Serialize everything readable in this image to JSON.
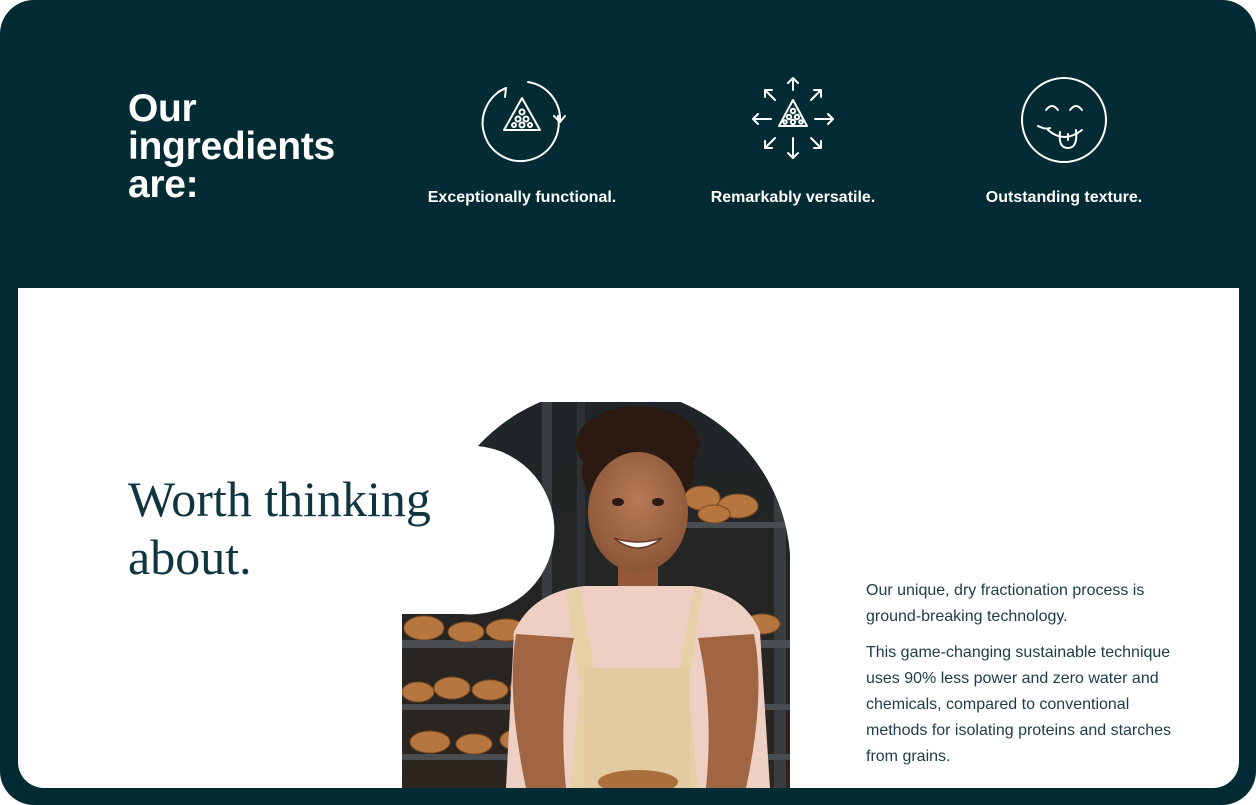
{
  "header": {
    "title_lines": [
      "Our",
      "ingredients",
      "are:"
    ],
    "features": [
      {
        "label": "Exceptionally functional.",
        "icon": "recycle-grain-icon"
      },
      {
        "label": "Remarkably versatile.",
        "icon": "expand-grain-icon"
      },
      {
        "label": "Outstanding texture.",
        "icon": "tongue-smile-icon"
      }
    ]
  },
  "section": {
    "headline_lines": [
      "Worth thinking",
      "about."
    ],
    "paragraphs": [
      "Our unique, dry fractionation process is ground-breaking technology.",
      "This game-changing sustainable technique uses 90% less power and zero water and chemicals, compared to conventional methods for isolating proteins and starches from grains."
    ],
    "image": "baker-woman-photo"
  },
  "colors": {
    "brand_dark": "#022b33",
    "text_dark": "#0f3540",
    "body_text": "#1d3c45",
    "white": "#ffffff"
  }
}
